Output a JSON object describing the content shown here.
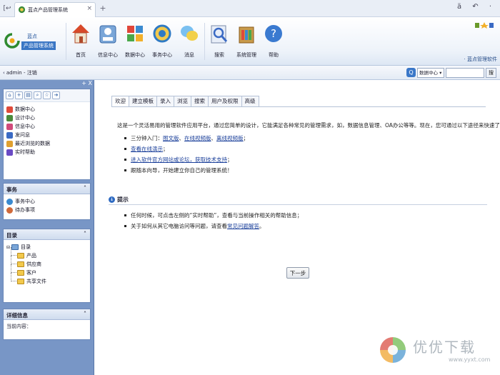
{
  "browser": {
    "tab_title": "蓝点产品管理系统",
    "tab_close": "×",
    "new_tab": "+",
    "back": "[↩",
    "top_right_icons": "ä ↶ ·"
  },
  "header": {
    "logo_small": "蓝点",
    "logo_text": "产品管理系统",
    "tools": [
      {
        "label": "首页"
      },
      {
        "label": "信息中心"
      },
      {
        "label": "数据中心"
      },
      {
        "label": "事务中心"
      },
      {
        "label": "消息"
      },
      {
        "label": "搜索"
      },
      {
        "label": "系统管理"
      },
      {
        "label": "帮助"
      }
    ],
    "right_link": "· 蓝点管理软件"
  },
  "crumb": {
    "arrow": "‹",
    "text": "admin - 注销"
  },
  "search": {
    "select_value": "数据中心 ▾",
    "input_value": "",
    "go_label": "搜"
  },
  "sidebar": {
    "top_ctl": "+ X",
    "nav_items": [
      {
        "label": "数据中心",
        "color": "#e04a3a"
      },
      {
        "label": "设计中心",
        "color": "#4a8a3a"
      },
      {
        "label": "信息中心",
        "color": "#d04a7a"
      },
      {
        "label": "发问息",
        "color": "#3a6ac4"
      },
      {
        "label": "最近浏览的数据",
        "color": "#e0a030"
      },
      {
        "label": "实时帮助",
        "color": "#6a4ac4"
      }
    ],
    "affairs": {
      "title": "事务",
      "items": [
        {
          "label": "事务中心",
          "color": "#3a8ad0"
        },
        {
          "label": "待办事项",
          "color": "#d06a3a"
        }
      ]
    },
    "directory": {
      "title": "目录",
      "root": "目录",
      "items": [
        "产品",
        "供应商",
        "客户",
        "共享文件"
      ]
    },
    "details": {
      "title": "详细信息",
      "current": "当前内容："
    }
  },
  "main": {
    "tabs": [
      "欢迎",
      "建立模板",
      "录入",
      "浏览",
      "搜索",
      "用户及权限",
      "高级"
    ],
    "intro": "这是一个灵活易用的管理软件应用平台，通过您简单的设计，它能满足各种常见的管理需求，如，数据信息管理、OA办公等等。现在，您可通过以下途径来快速了解它：",
    "bullets": [
      {
        "prefix": "三分钟入门：",
        "links": [
          "图文版",
          "在线视频版",
          "离线视频版"
        ],
        "suffix": "；"
      },
      {
        "prefix": "",
        "links": [
          "查看在线演示"
        ],
        "suffix": "；"
      },
      {
        "prefix": "",
        "links": [
          "进入软件官方网站或论坛，获取技术支持"
        ],
        "suffix": "；"
      },
      {
        "prefix": "跟随本向导，开始建立你自己的管理系统！",
        "links": [],
        "suffix": ""
      }
    ],
    "hint_title": "提示",
    "hints": [
      {
        "text": "任何时候，可点击左侧的“实时帮助”，查看与当前操作相关的帮助信息；",
        "link": "",
        "suffix": ""
      },
      {
        "text": "关于如何从其它电脑访问等问题，请查看",
        "link": "常见问题解答",
        "suffix": "。"
      }
    ],
    "next_button": "下一步"
  },
  "watermark": {
    "cn": "优优下载",
    "url": "www.yyxt.com"
  }
}
